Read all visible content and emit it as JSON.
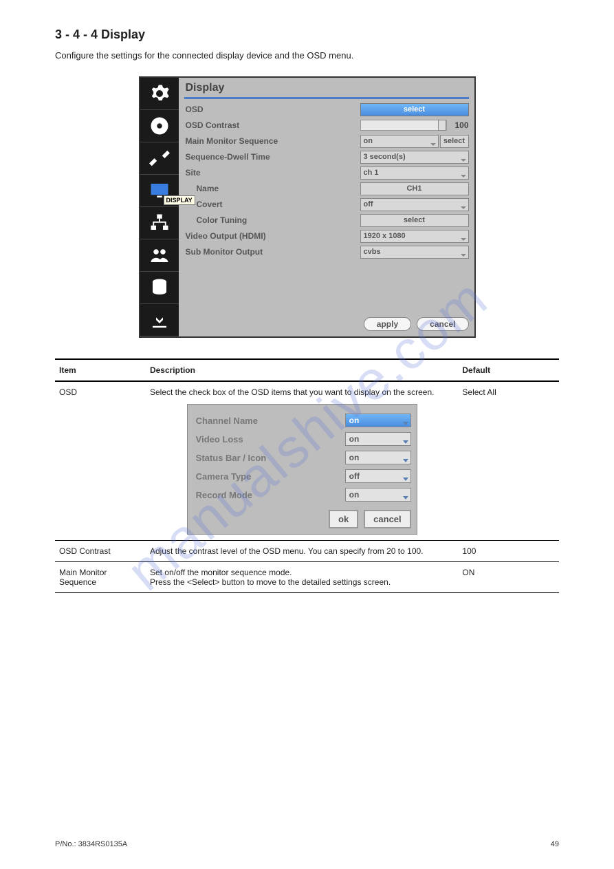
{
  "watermark": "manualshive.com",
  "page": {
    "title": "3 - 4 - 4   Display",
    "intro": "Configure the settings for the connected display device and the OSD menu."
  },
  "dialog": {
    "title": "Display",
    "tooltip": "DISPLAY",
    "rows": {
      "osd": {
        "label": "OSD",
        "btn": "select"
      },
      "contrast": {
        "label": "OSD Contrast",
        "value": "100"
      },
      "mainseq": {
        "label": "Main Monitor Sequence",
        "value": "on",
        "btn": "select"
      },
      "dwell": {
        "label": "Sequence-Dwell Time",
        "value": "3 second(s)"
      },
      "site": {
        "label": "Site",
        "value": "ch 1"
      },
      "name": {
        "label": "Name",
        "value": "CH1"
      },
      "covert": {
        "label": "Covert",
        "value": "off"
      },
      "color": {
        "label": "Color Tuning",
        "value": "select"
      },
      "video": {
        "label": "Video Output (HDMI)",
        "value": "1920 x 1080"
      },
      "sub": {
        "label": "Sub Monitor Output",
        "value": "cvbs"
      }
    },
    "footer": {
      "apply": "apply",
      "cancel": "cancel"
    }
  },
  "table": {
    "headers": {
      "item": "Item",
      "desc": "Description",
      "def": "Default"
    },
    "osd_item": "OSD",
    "osd_desc": "Select the check box of the OSD items that you want to display on the screen.",
    "osd_def": "Select All",
    "contrast_item": "OSD Contrast",
    "contrast_desc": "Adjust the contrast level of the OSD menu. You can specify from 20 to 100.",
    "contrast_def": "100",
    "mainseq_item_1": "Main Monitor",
    "mainseq_item_2": "Sequence",
    "mainseq_desc_1": "Set on/off the monitor sequence mode.",
    "mainseq_desc_2": "Press the <Select> button to move to the detailed settings screen.",
    "mainseq_def_1": "ON",
    "mainseq_def_2": ""
  },
  "osd_popup": {
    "rows": {
      "chname": {
        "label": "Channel Name",
        "value": "on"
      },
      "vloss": {
        "label": "Video Loss",
        "value": "on"
      },
      "status": {
        "label": "Status Bar / Icon",
        "value": "on"
      },
      "camtype": {
        "label": "Camera Type",
        "value": "off"
      },
      "recmode": {
        "label": "Record Mode",
        "value": "on"
      }
    },
    "footer": {
      "ok": "ok",
      "cancel": "cancel"
    }
  },
  "footer": {
    "left": "P/No.: 3834RS0135A",
    "right": "49"
  }
}
